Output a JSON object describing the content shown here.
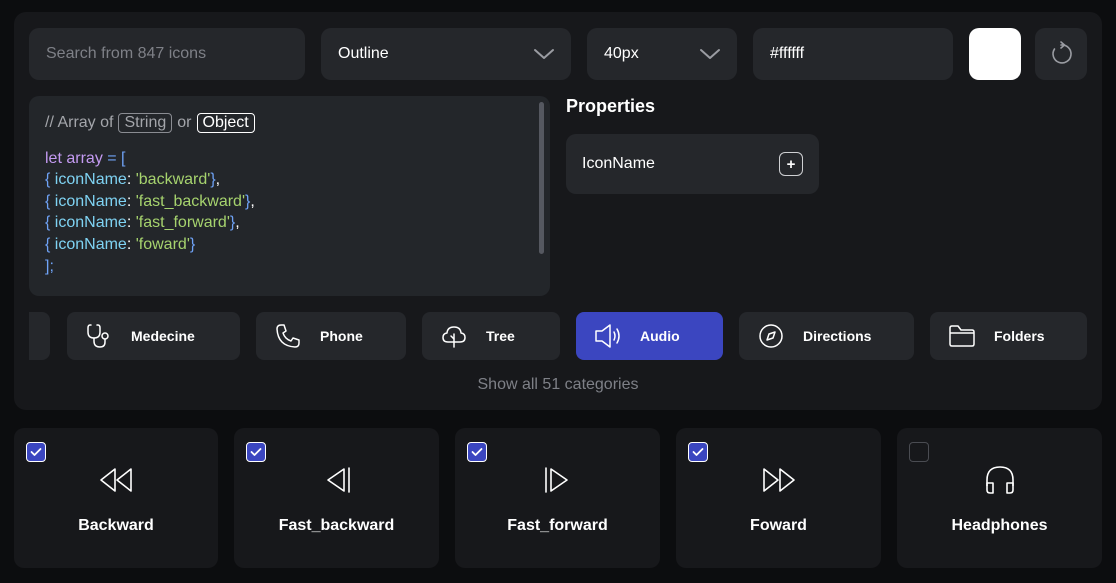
{
  "toolbar": {
    "search_placeholder": "Search from 847 icons",
    "style_value": "Outline",
    "size_value": "40px",
    "color_value": "#ffffff",
    "swatch_color": "#ffffff"
  },
  "code": {
    "comment": "// Array of",
    "type_string": "String",
    "or": "or",
    "type_object": "Object",
    "lines": [
      {
        "kw": "let",
        "var": "array",
        "rest": " = ["
      },
      {
        "name": "backward"
      },
      {
        "name": "fast_backward"
      },
      {
        "name": "fast_forward"
      },
      {
        "name": "foward",
        "last": true
      }
    ],
    "close": "];",
    "key": "iconName"
  },
  "properties": {
    "title": "Properties",
    "items": [
      {
        "label": "IconName",
        "action": "+"
      }
    ]
  },
  "categories": [
    {
      "label": "Medecine",
      "icon": "stethoscope-icon",
      "active": false
    },
    {
      "label": "Phone",
      "icon": "phone-icon",
      "active": false
    },
    {
      "label": "Tree",
      "icon": "tree-icon",
      "active": false
    },
    {
      "label": "Audio",
      "icon": "speaker-icon",
      "active": true
    },
    {
      "label": "Directions",
      "icon": "compass-icon",
      "active": false
    },
    {
      "label": "Folders",
      "icon": "folder-icon",
      "active": false
    }
  ],
  "show_all": "Show all 51 categories",
  "icons": [
    {
      "label": "Backward",
      "icon": "backward-icon",
      "checked": true
    },
    {
      "label": "Fast_backward",
      "icon": "fast-backward-icon",
      "checked": true
    },
    {
      "label": "Fast_forward",
      "icon": "fast-forward-icon",
      "checked": true
    },
    {
      "label": "Foward",
      "icon": "forward-icon",
      "checked": true
    },
    {
      "label": "Headphones",
      "icon": "headphones-icon",
      "checked": false
    }
  ],
  "colors": {
    "accent": "#3b46c0",
    "panel": "#17181b",
    "control": "#25272b"
  }
}
